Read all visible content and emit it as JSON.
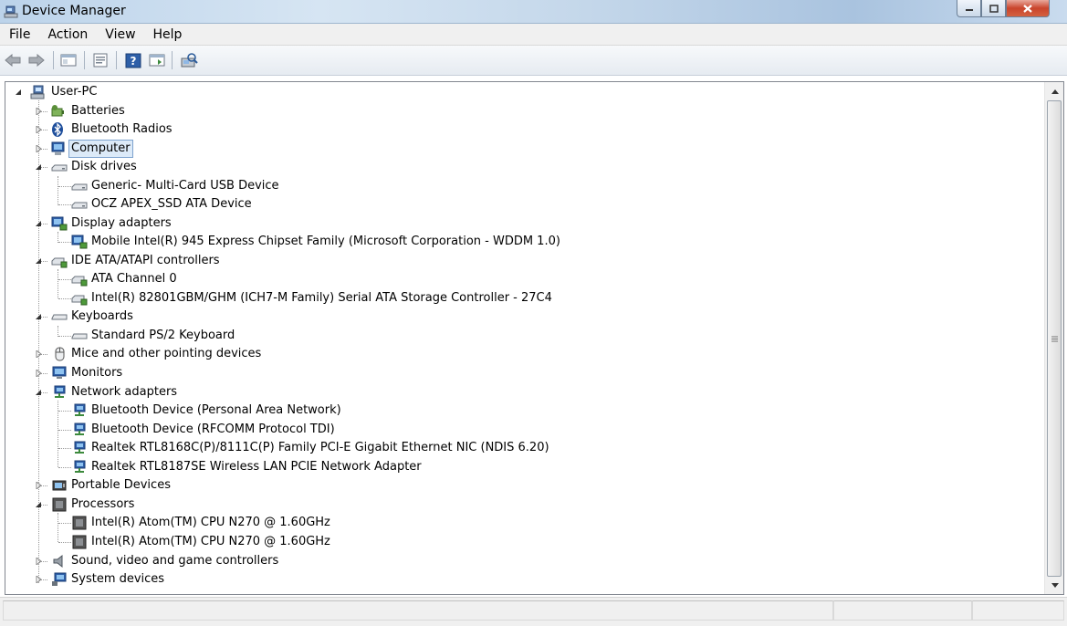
{
  "window": {
    "title": "Device Manager",
    "icon": "device-manager-icon",
    "controls": [
      "minimize-icon",
      "maximize-icon",
      "close-icon"
    ]
  },
  "menu": {
    "items": [
      "File",
      "Action",
      "View",
      "Help"
    ]
  },
  "toolbar": {
    "buttons": [
      "back-arrow-icon",
      "forward-arrow-icon",
      "show-hide-tree-icon",
      "properties-icon",
      "help-icon",
      "run-icon",
      "scan-hardware-icon"
    ]
  },
  "tree": {
    "root": "User-PC",
    "nodes": [
      {
        "label": "Batteries",
        "icon": "battery-icon",
        "expanded": false
      },
      {
        "label": "Bluetooth Radios",
        "icon": "bluetooth-icon",
        "expanded": false
      },
      {
        "label": "Computer",
        "icon": "computer-icon",
        "expanded": false,
        "selected": true
      },
      {
        "label": "Disk drives",
        "icon": "disk-drive-icon",
        "expanded": true,
        "children": [
          "Generic- Multi-Card USB Device",
          "OCZ APEX_SSD ATA Device"
        ]
      },
      {
        "label": "Display adapters",
        "icon": "display-adapter-icon",
        "expanded": true,
        "children": [
          "Mobile Intel(R) 945 Express Chipset Family (Microsoft Corporation - WDDM 1.0)"
        ]
      },
      {
        "label": "IDE ATA/ATAPI controllers",
        "icon": "ide-controller-icon",
        "expanded": true,
        "children": [
          "ATA Channel 0",
          "Intel(R) 82801GBM/GHM (ICH7-M Family) Serial ATA Storage Controller - 27C4"
        ]
      },
      {
        "label": "Keyboards",
        "icon": "keyboard-icon",
        "expanded": true,
        "children": [
          "Standard PS/2 Keyboard"
        ]
      },
      {
        "label": "Mice and other pointing devices",
        "icon": "mouse-icon",
        "expanded": false
      },
      {
        "label": "Monitors",
        "icon": "monitor-icon",
        "expanded": false
      },
      {
        "label": "Network adapters",
        "icon": "network-adapter-icon",
        "expanded": true,
        "children": [
          "Bluetooth Device (Personal Area Network)",
          "Bluetooth Device (RFCOMM Protocol TDI)",
          "Realtek RTL8168C(P)/8111C(P) Family PCI-E Gigabit Ethernet NIC (NDIS 6.20)",
          "Realtek RTL8187SE Wireless LAN PCIE Network Adapter"
        ]
      },
      {
        "label": "Portable Devices",
        "icon": "portable-device-icon",
        "expanded": false
      },
      {
        "label": "Processors",
        "icon": "processor-icon",
        "expanded": true,
        "children": [
          "Intel(R) Atom(TM) CPU N270   @ 1.60GHz",
          "Intel(R) Atom(TM) CPU N270   @ 1.60GHz"
        ]
      },
      {
        "label": "Sound, video and game controllers",
        "icon": "speaker-icon",
        "expanded": false
      },
      {
        "label": "System devices",
        "icon": "system-device-icon",
        "expanded": false
      }
    ]
  },
  "status": {
    "text": ""
  },
  "colors": {
    "selection_bg": "#dceaf8",
    "selection_border": "#7da2ce",
    "titlebar": "#c4d7ea"
  }
}
